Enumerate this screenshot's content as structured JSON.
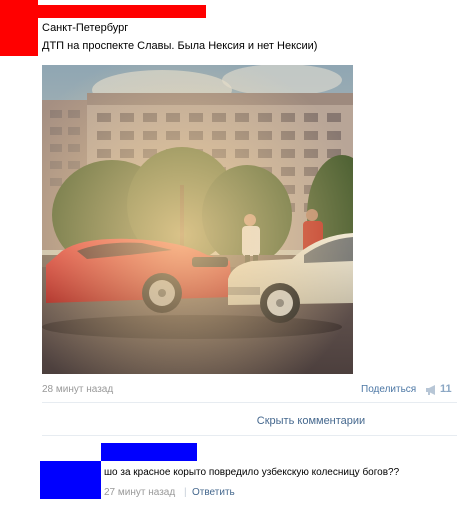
{
  "post": {
    "author": "Санкт-Петербург",
    "text": "ДТП на проспекте Славы. Была Нексия и нет Нексии)",
    "time": "28 минут назад",
    "share_label": "Поделиться",
    "share_count": "11"
  },
  "comments_toggle": "Скрыть комментарии",
  "comment": {
    "text": "шо за красное корыто повредило узбекскую колесницу богов??",
    "time": "27 минут назад",
    "separator": "|",
    "reply_label": "Ответить"
  },
  "colors": {
    "redaction_red": "#ff0000",
    "redaction_blue": "#0000ff",
    "link": "#45688e",
    "muted": "#999999"
  },
  "icons": {
    "device": "apple-icon",
    "share": "megaphone-icon"
  }
}
